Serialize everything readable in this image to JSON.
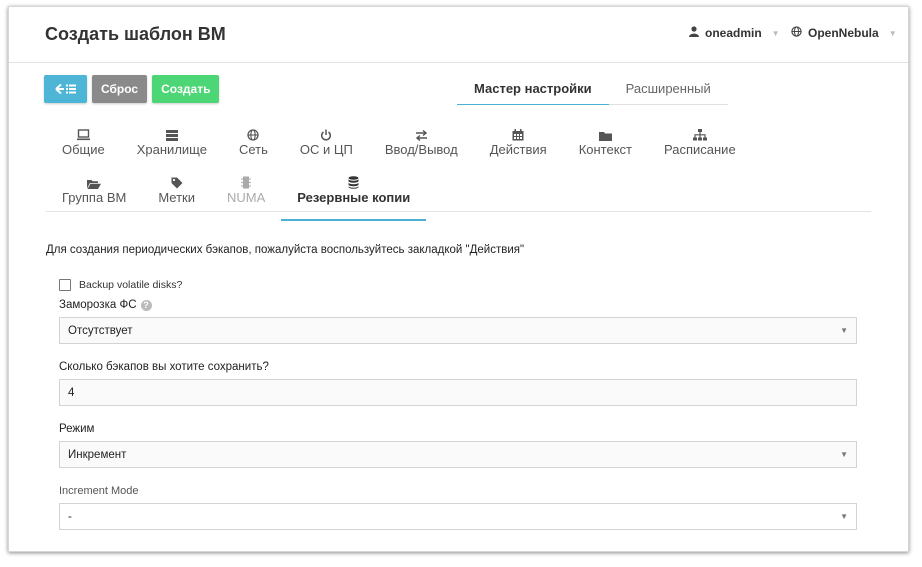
{
  "header": {
    "title": "Создать шаблон ВМ",
    "user": "oneadmin",
    "zone": "OpenNebula"
  },
  "toolbar": {
    "reset_label": "Сброс",
    "create_label": "Создать"
  },
  "mode_tabs": [
    {
      "label": "Мастер настройки",
      "active": true
    },
    {
      "label": "Расширенный",
      "active": false
    }
  ],
  "section_tabs": {
    "row1": [
      {
        "label": "Общие",
        "icon": "desktop-icon"
      },
      {
        "label": "Хранилище",
        "icon": "server-icon"
      },
      {
        "label": "Сеть",
        "icon": "globe-icon"
      },
      {
        "label": "ОС и ЦП",
        "icon": "power-icon"
      },
      {
        "label": "Ввод/Вывод",
        "icon": "exchange-icon"
      },
      {
        "label": "Действия",
        "icon": "calendar-icon"
      },
      {
        "label": "Контекст",
        "icon": "folder-icon"
      },
      {
        "label": "Расписание",
        "icon": "sitemap-icon"
      }
    ],
    "row2": [
      {
        "label": "Группа ВМ",
        "icon": "folder-open-icon"
      },
      {
        "label": "Метки",
        "icon": "tag-icon"
      },
      {
        "label": "NUMA",
        "icon": "microchip-icon",
        "disabled": true
      },
      {
        "label": "Резервные копии",
        "icon": "database-icon",
        "active": true
      }
    ]
  },
  "backups": {
    "intro": "Для создания периодических бэкапов, пожалуйста воспользуйтесь закладкой \"Действия\"",
    "volatile_label": "Backup volatile disks?",
    "volatile_checked": false,
    "fs_freeze": {
      "label": "Заморозка ФС",
      "value": "Отсутствует"
    },
    "keep": {
      "label": "Сколько бэкапов вы хотите сохранить?",
      "value": "4"
    },
    "mode": {
      "label": "Режим",
      "value": "Инкремент"
    },
    "increment_mode": {
      "label": "Increment Mode",
      "value": "-"
    }
  },
  "colors": {
    "accent": "#4bb0d3",
    "back_button": "#4db5d6",
    "reset_button": "#8a8a8a",
    "create_button": "#4cd676"
  }
}
